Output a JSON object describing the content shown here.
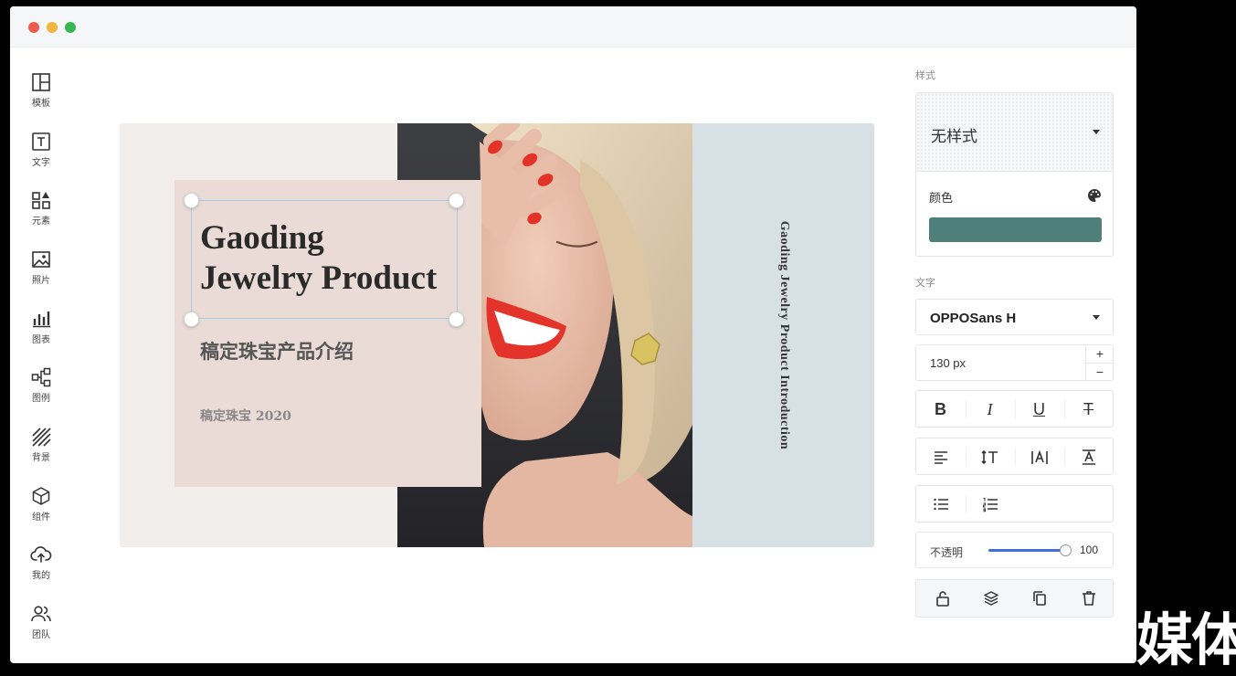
{
  "sidebar": {
    "items": [
      {
        "label": "模板",
        "icon": "layout-icon"
      },
      {
        "label": "文字",
        "icon": "text-icon"
      },
      {
        "label": "元素",
        "icon": "shapes-icon"
      },
      {
        "label": "照片",
        "icon": "image-icon"
      },
      {
        "label": "图表",
        "icon": "bar-chart-icon"
      },
      {
        "label": "图例",
        "icon": "diagram-icon"
      },
      {
        "label": "背景",
        "icon": "stripes-icon"
      },
      {
        "label": "组件",
        "icon": "cube-icon"
      },
      {
        "label": "我的",
        "icon": "cloud-upload-icon"
      },
      {
        "label": "团队",
        "icon": "team-icon"
      }
    ]
  },
  "canvas": {
    "title_line1": "Gaoding",
    "title_line2": "Jewelry Product",
    "subtitle": "稿定珠宝产品介绍",
    "small_text": "稿定珠宝 2020",
    "vertical_text": "Gaoding Jewelry Product Introduction"
  },
  "panel": {
    "style_section": "样式",
    "style_value": "无样式",
    "color_label": "颜色",
    "color_value": "#4f7f7b",
    "text_section": "文字",
    "font_name": "OPPOSans H",
    "font_size": "130 px",
    "plus": "+",
    "minus": "−",
    "bold": "B",
    "italic": "I",
    "underline": "U",
    "strike": "T",
    "opacity_label": "不透明",
    "opacity_value": "100"
  },
  "colors": {
    "canvas_bg": "#f1eeeb",
    "pink_card": "#eadbd6",
    "side_band": "#d7e1e5",
    "accent": "#3f6fd8"
  },
  "watermark": "媒体"
}
